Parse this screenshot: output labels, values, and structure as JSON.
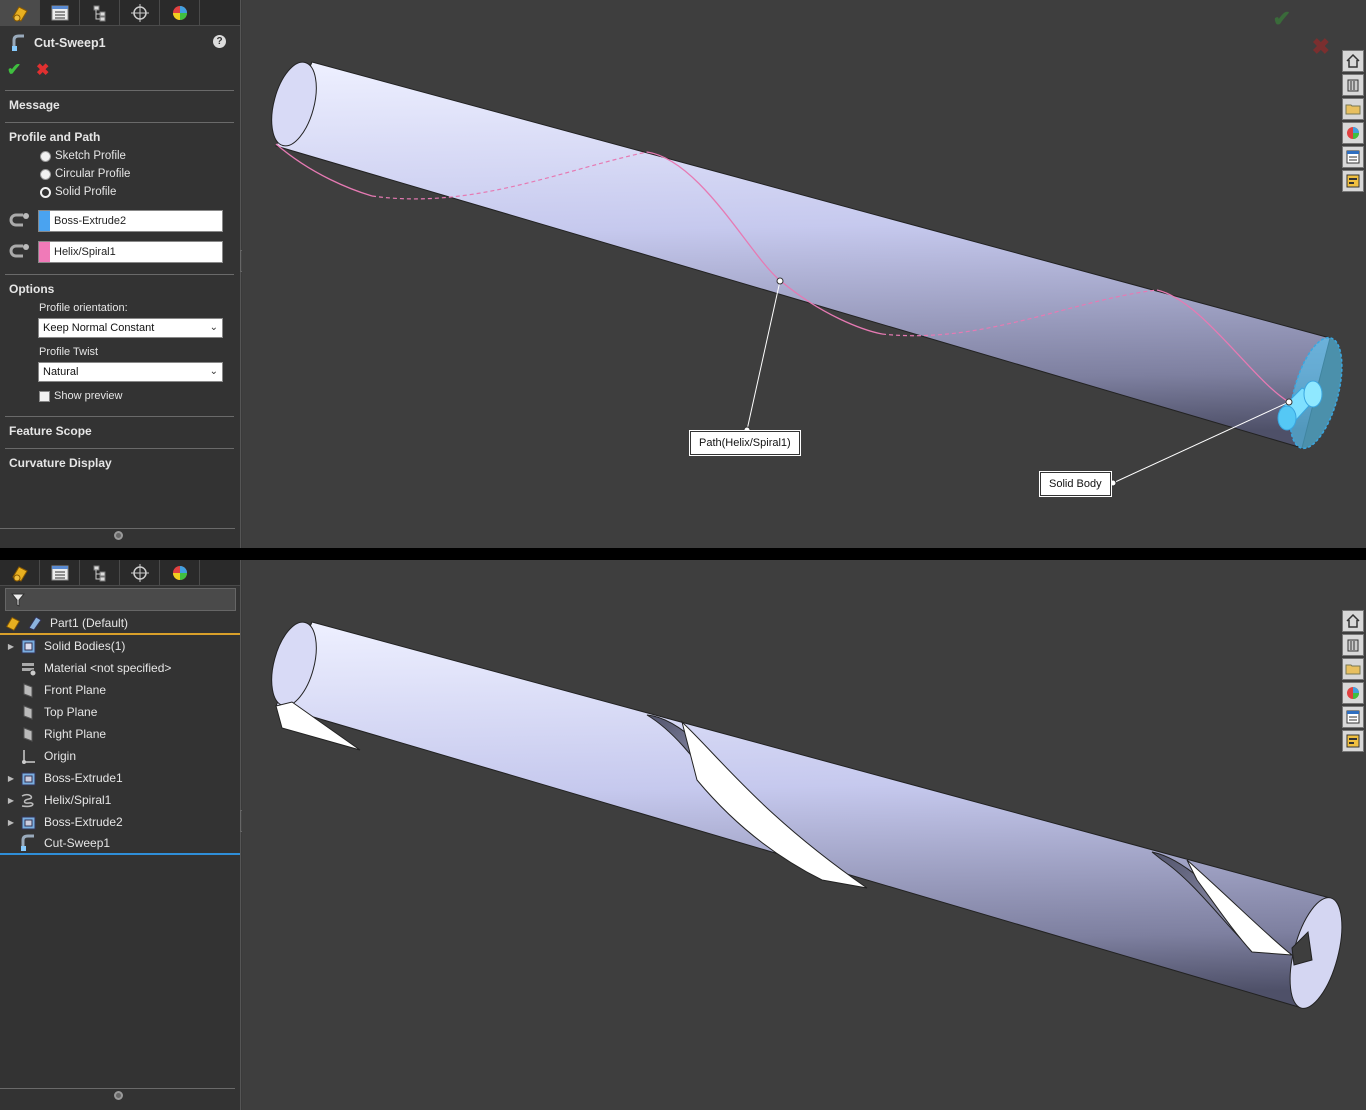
{
  "property_manager": {
    "title": "Cut-Sweep1",
    "help": "?",
    "ok_symbol": "✔",
    "cancel_symbol": "✖",
    "sections": {
      "message": "Message",
      "profile_and_path": "Profile and Path",
      "options": "Options",
      "feature_scope": "Feature Scope",
      "curvature_display": "Curvature Display"
    },
    "profile_types": [
      {
        "label": "Sketch Profile",
        "selected": false
      },
      {
        "label": "Circular Profile",
        "selected": false
      },
      {
        "label": "Solid Profile",
        "selected": true
      }
    ],
    "profile_selection": {
      "value": "Boss-Extrude2",
      "color": "#4aa3f0"
    },
    "path_selection": {
      "value": "Helix/Spiral1",
      "color": "#f07ab8"
    },
    "profile_orientation_label": "Profile orientation:",
    "profile_orientation_value": "Keep Normal Constant",
    "profile_twist_label": "Profile Twist",
    "profile_twist_value": "Natural",
    "show_preview_label": "Show preview",
    "show_preview_checked": false
  },
  "viewport_top": {
    "callout_path": "Path(Helix/Spiral1)",
    "callout_solid": "Solid Body",
    "ok_symbol": "✔",
    "cancel_symbol": "✖"
  },
  "feature_tree": {
    "root": "Part1  (Default)",
    "items": [
      {
        "label": "Solid Bodies(1)",
        "expandable": true,
        "icon": "solid-bodies-icon"
      },
      {
        "label": "Material <not specified>",
        "expandable": false,
        "icon": "material-icon"
      },
      {
        "label": "Front Plane",
        "expandable": false,
        "icon": "plane-icon"
      },
      {
        "label": "Top Plane",
        "expandable": false,
        "icon": "plane-icon"
      },
      {
        "label": "Right Plane",
        "expandable": false,
        "icon": "plane-icon"
      },
      {
        "label": "Origin",
        "expandable": false,
        "icon": "origin-icon"
      },
      {
        "label": "Boss-Extrude1",
        "expandable": true,
        "icon": "extrude-icon"
      },
      {
        "label": "Helix/Spiral1",
        "expandable": true,
        "icon": "helix-icon"
      },
      {
        "label": "Boss-Extrude2",
        "expandable": true,
        "icon": "extrude-icon"
      },
      {
        "label": "Cut-Sweep1",
        "expandable": false,
        "icon": "sweep-icon"
      }
    ]
  },
  "colors": {
    "body": "#c8cbf0",
    "helix": "#e67ab3",
    "selection": "#55c8f5",
    "ui_dark": "#333333"
  }
}
